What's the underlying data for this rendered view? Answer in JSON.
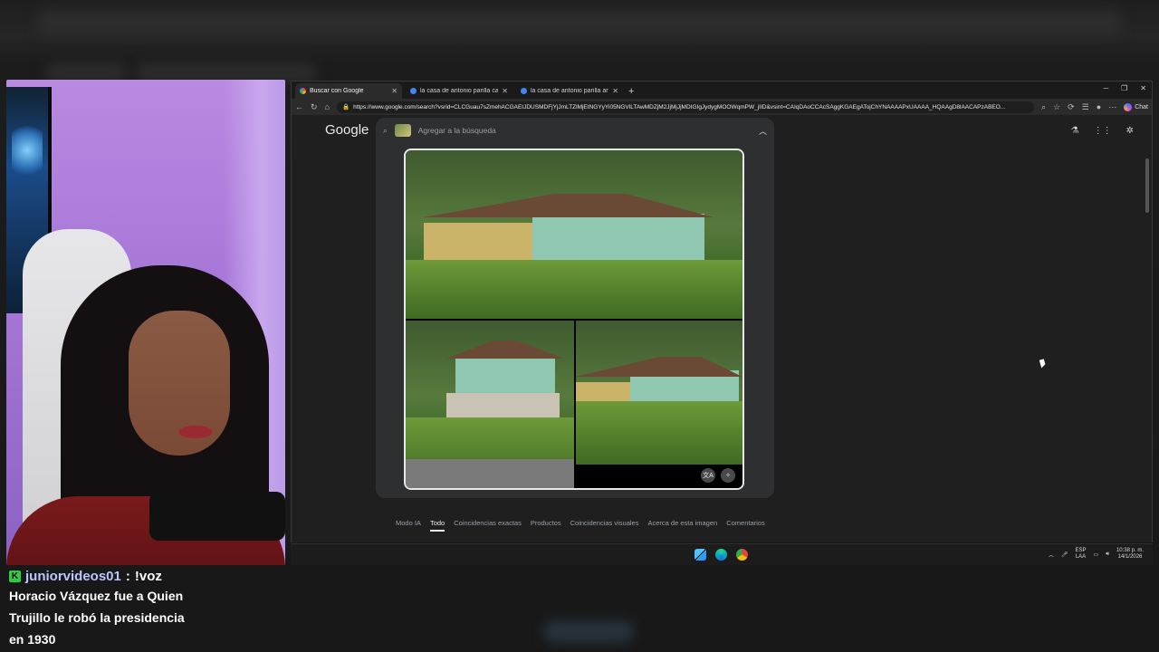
{
  "chat": {
    "username": "juniorvideos01",
    "separator": ":",
    "command": "!voz",
    "message_lines": [
      "Horacio Vázquez fue a Quien",
      "Trujillo le robó la presidencia",
      "en 1930"
    ],
    "badge_icon": "kick-icon",
    "badge_letter": "K",
    "user_color": "#b9c6ff"
  },
  "browser": {
    "tabs": [
      {
        "title": "Buscar con Google",
        "active": true
      },
      {
        "title": "la casa de antonio parilla castillo",
        "active": false
      },
      {
        "title": "la casa de antonio parilla antes de",
        "active": false
      }
    ],
    "new_tab_symbol": "+",
    "url": "https://www.google.com/search?vsrid=CLCGuau7sZmehACGAEIJDUSMDFjYjJmLTZlMjEtNGYyYi05NGVlLTAwMDZjM2JjMjJjMDIGIgJydygMOOWqmPW_jIID&vsint=CAIqDAoCCAcSAggKGAEgATojChYNAAAAPxUAAAA_HQAAgD8lAACAPzABEO...",
    "copilot_label": "Chat"
  },
  "google": {
    "logo": "Google",
    "search_placeholder": "Agregar a la búsqueda",
    "filters": [
      "Modo IA",
      "Todo",
      "Coincidencias exactas",
      "Productos",
      "Coincidencias visuales",
      "Acerca de esta imagen",
      "Comentarios"
    ],
    "active_filter": "Todo"
  },
  "taskbar": {
    "lang_top": "ESP",
    "lang_bottom": "LAA",
    "time": "10:38 p. m.",
    "date": "14/1/2026"
  },
  "colors": {
    "page_bg": "#1f1f1f",
    "panel_bg": "#2e2f31",
    "accent_green": "#2ecc40"
  }
}
